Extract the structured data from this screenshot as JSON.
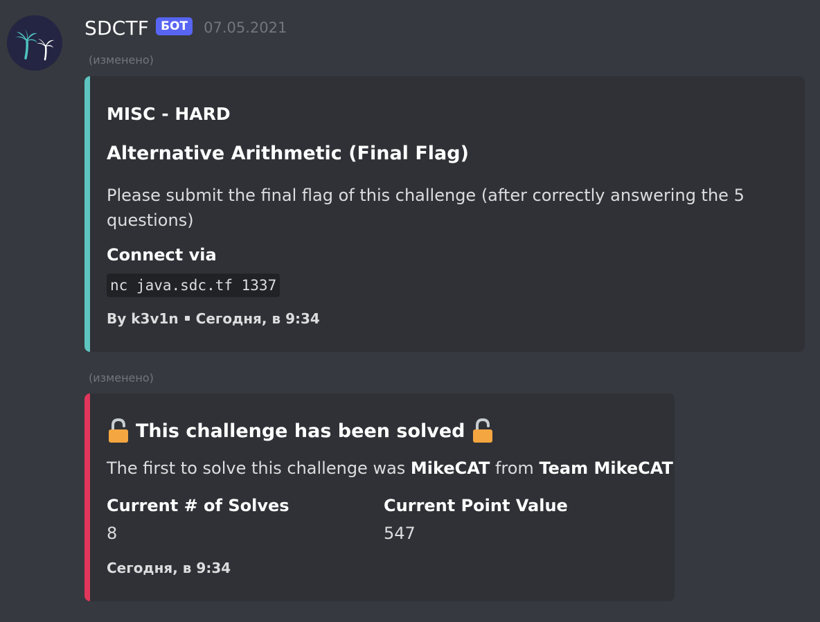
{
  "colors": {
    "background": "#36393f",
    "embed_background": "#2f3136",
    "embed1_accent": "#5ec4c0",
    "embed2_accent": "#e0365b",
    "bot_tag": "#5865f2"
  },
  "message": {
    "username": "SDCTF",
    "bot_tag": "БОТ",
    "timestamp": "07.05.2021",
    "avatar_icon": "palm-trees-icon",
    "edited_label": "(изменено)"
  },
  "embed1": {
    "author": "MISC - HARD",
    "title": "Alternative Arithmetic (Final Flag)",
    "description": "Please submit the final flag of this challenge (after correctly answering the 5 questions)",
    "connect_label": "Connect via",
    "connect_code": "nc java.sdc.tf 1337",
    "footer_author": "By k3v1n",
    "footer_time": "Сегодня, в 9:34"
  },
  "embed2": {
    "title": "This challenge has been solved",
    "title_icon": "unlocked-lock-icon",
    "desc_prefix": "The first to solve this challenge was ",
    "solver": "MikeCAT",
    "desc_middle": " from ",
    "team": "Team MikeCAT",
    "fields": [
      {
        "name": "Current # of Solves",
        "value": "8"
      },
      {
        "name": "Current Point Value",
        "value": "547"
      }
    ],
    "footer_time": "Сегодня, в 9:34"
  }
}
